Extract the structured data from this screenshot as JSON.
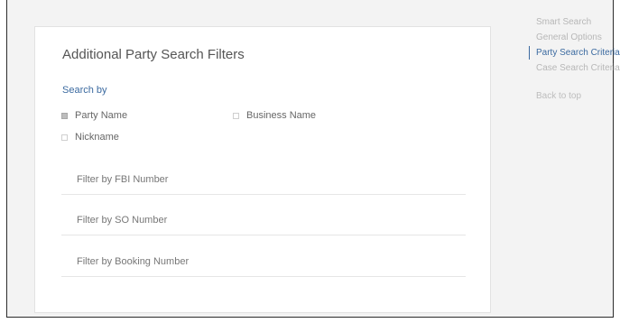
{
  "card": {
    "title": "Additional Party Search Filters",
    "search_by_label": "Search by"
  },
  "options": [
    {
      "label": "Party Name",
      "checked": true
    },
    {
      "label": "Business Name",
      "checked": false
    },
    {
      "label": "Nickname",
      "checked": false
    }
  ],
  "filters": [
    {
      "placeholder": "Filter by FBI Number"
    },
    {
      "placeholder": "Filter by SO Number"
    },
    {
      "placeholder": "Filter by Booking Number"
    }
  ],
  "toc": {
    "items": [
      "Smart Search",
      "General Options",
      "Party Search Criteria",
      "Case Search Criteria"
    ],
    "active_index": 2,
    "back_to_top": "Back to top"
  },
  "colors": {
    "accent": "#3b6aa0",
    "muted": "#b7b7b7"
  }
}
